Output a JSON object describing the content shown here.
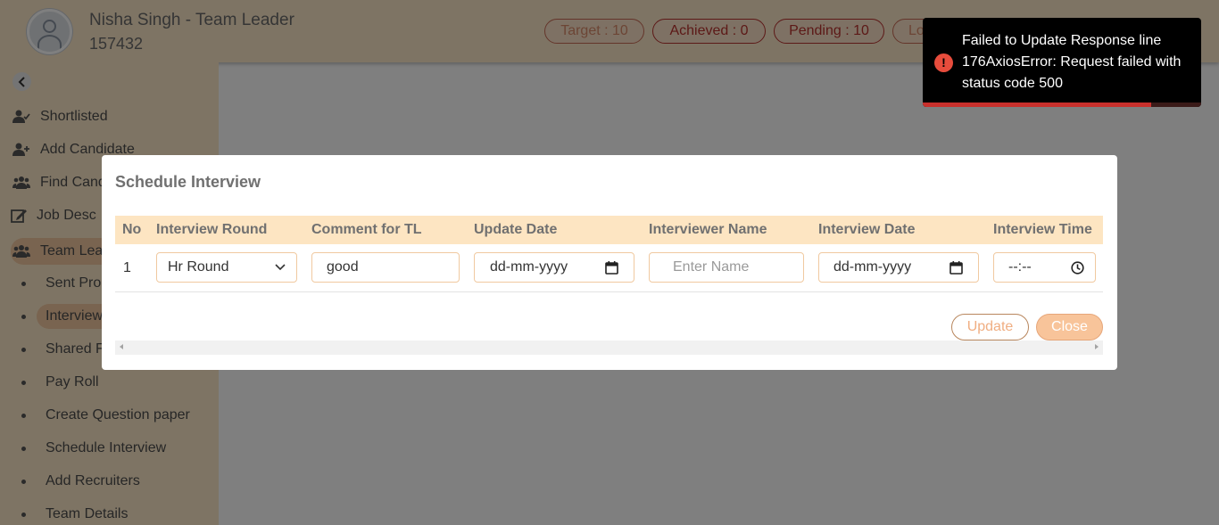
{
  "header": {
    "user_name": "Nisha Singh - Team Leader",
    "user_id": "157432",
    "stats": {
      "target": "Target : 10",
      "achieved": "Achieved : 0",
      "pending": "Pending : 10",
      "logout": "Lo"
    }
  },
  "sidebar": {
    "items": [
      {
        "label": "Shortlisted",
        "icon": "user-check-icon"
      },
      {
        "label": "Add Candidate",
        "icon": "user-plus-icon"
      },
      {
        "label": "Find Cand",
        "icon": "users-icon"
      },
      {
        "label": "Job Desc",
        "icon": "edit-icon"
      },
      {
        "label": "Team Lea",
        "icon": "users-icon"
      }
    ],
    "sub_items": [
      {
        "label": "Sent Pro"
      },
      {
        "label": "Interview"
      },
      {
        "label": "Shared F"
      },
      {
        "label": "Pay Roll"
      },
      {
        "label": "Create Question paper"
      },
      {
        "label": "Schedule Interview"
      },
      {
        "label": "Add Recruiters"
      },
      {
        "label": "Team Details"
      }
    ]
  },
  "modal": {
    "title": "Schedule Interview",
    "columns": [
      "No",
      "Interview Round",
      "Comment for TL",
      "Update Date",
      "Interviewer Name",
      "Interview Date",
      "Interview Time"
    ],
    "row": {
      "no": "1",
      "interview_round": "Hr Round",
      "comment": "good",
      "update_date_placeholder": "dd-mm-yyyy",
      "interviewer_name_placeholder": "Enter Name",
      "interview_date_placeholder": "dd-mm-yyyy",
      "interview_time_placeholder": "--:--"
    },
    "buttons": {
      "update": "Update",
      "close": "Close"
    }
  },
  "toast": {
    "message": "Failed to Update Response line 176AxiosError: Request failed with status code 500",
    "icon": "error-icon",
    "icon_glyph": "!",
    "progress": 0.82
  },
  "colors": {
    "header_bg": "#fde9c9",
    "accent": "#f8c49a",
    "error": "#e74c3c"
  }
}
